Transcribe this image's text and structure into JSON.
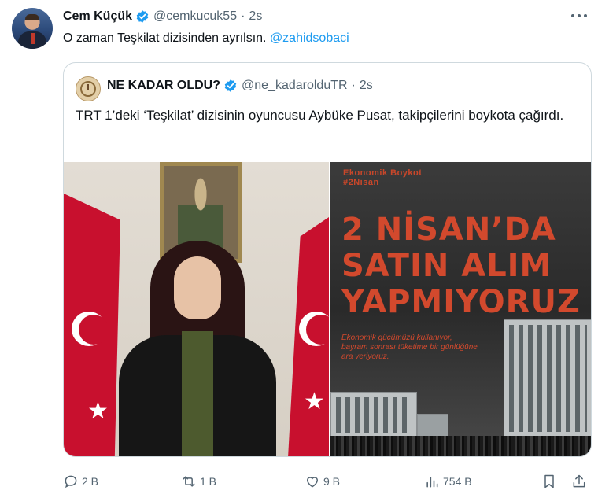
{
  "tweet": {
    "author_name": "Cem Küçük",
    "author_handle": "@cemkucuk55",
    "separator": "·",
    "time": "2s",
    "text": "O zaman Teşkilat dizisinden ayrılsın.",
    "mention": "@zahidsobaci"
  },
  "quote": {
    "author_name": "NE KADAR OLDU?",
    "author_handle": "@ne_kadarolduTR",
    "separator": "·",
    "time": "2s",
    "text": "TRT 1’deki ‘Teşkilat’ dizisinin oyuncusu Aybüke Pusat, takipçilerini boykota çağırdı."
  },
  "poster": {
    "tag_line1": "Ekonomik Boykot",
    "tag_line2": "#2Nisan",
    "headline_line1": "2 NİSAN’DA",
    "headline_line2": "SATIN ALIM",
    "headline_line3": "YAPMIYORUZ",
    "sub_line1": "Ekonomik gücümüzü kullanıyor,",
    "sub_line2": "bayram sonrası tüketime bir günlüğüne",
    "sub_line3": "ara veriyoruz."
  },
  "actions": {
    "replies": "2 B",
    "retweets": "1 B",
    "likes": "9 B",
    "views": "754 B"
  },
  "colors": {
    "verified": "#1d9bf0",
    "mention": "#1d9bf0",
    "muted": "#536471",
    "poster_red": "#d2492d",
    "flag_red": "#c8102e"
  },
  "icons": [
    "more-icon",
    "verified-badge-icon",
    "reply-icon",
    "retweet-icon",
    "like-icon",
    "views-icon",
    "bookmark-icon",
    "share-icon"
  ]
}
